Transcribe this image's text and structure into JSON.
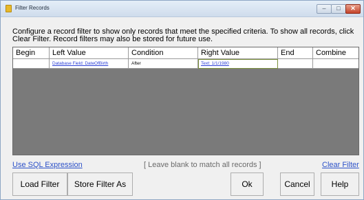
{
  "window": {
    "title": "Filter Records",
    "controls": {
      "minimize": "–",
      "maximize": "□",
      "close": "✕"
    }
  },
  "description": "Configure a record filter to show only records that meet the specified criteria. To show all records, click Clear Filter. Record filters may also be stored for future use.",
  "grid": {
    "columns": [
      "Begin",
      "Left Value",
      "Condition",
      "Right Value",
      "End",
      "Combine"
    ],
    "rows": [
      {
        "begin": "",
        "left_value": "Database Field: DateOfBirth",
        "condition": "After",
        "right_value": "Text: 1/1/1980",
        "end": "",
        "combine": ""
      }
    ]
  },
  "links": {
    "sql": "Use SQL Expression",
    "clear": "Clear Filter"
  },
  "hint": "[ Leave blank to match all records ]",
  "buttons": {
    "load": "Load Filter",
    "store": "Store Filter As",
    "ok": "Ok",
    "cancel": "Cancel",
    "help": "Help"
  }
}
